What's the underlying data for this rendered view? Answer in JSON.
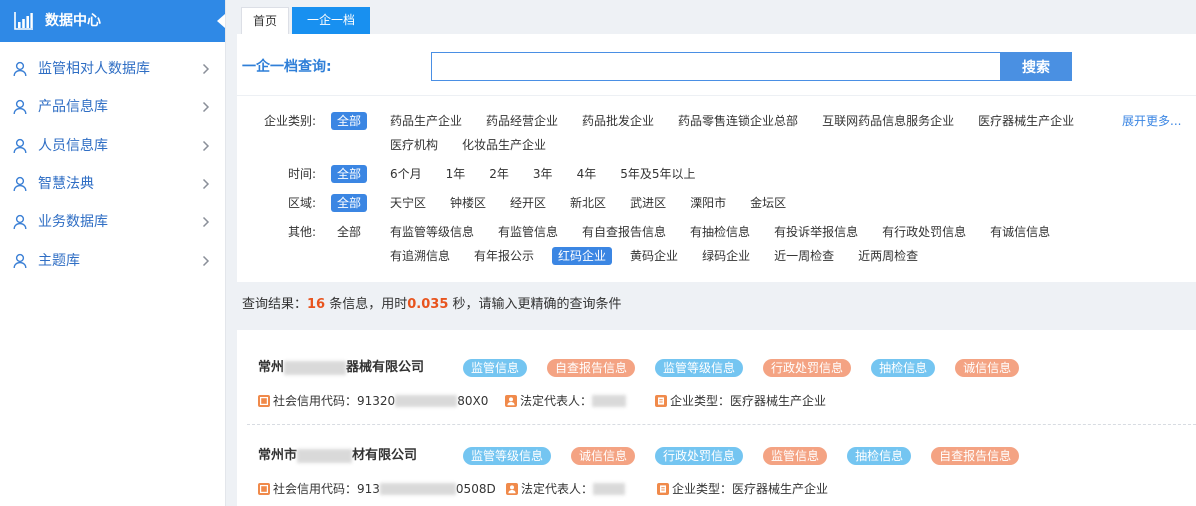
{
  "sidebar": {
    "title": "数据中心",
    "title_icon": "bar-chart-icon",
    "items": [
      {
        "label": "监管相对人数据库",
        "icon": "user-icon"
      },
      {
        "label": "产品信息库",
        "icon": "user-icon"
      },
      {
        "label": "人员信息库",
        "icon": "user-icon"
      },
      {
        "label": "智慧法典",
        "icon": "user-icon"
      },
      {
        "label": "业务数据库",
        "icon": "user-icon"
      },
      {
        "label": "主题库",
        "icon": "user-icon"
      }
    ]
  },
  "tabs": [
    {
      "label": "首页",
      "active": false
    },
    {
      "label": "一企一档",
      "active": true
    }
  ],
  "search": {
    "label": "一企一档查询:",
    "value": "",
    "button_label": "搜索"
  },
  "filters": {
    "category": {
      "label": "企业类别:",
      "all": {
        "label": "全部",
        "active": true
      },
      "options": [
        {
          "label": "药品生产企业"
        },
        {
          "label": "药品经营企业"
        },
        {
          "label": "药品批发企业"
        },
        {
          "label": "药品零售连锁企业总部"
        },
        {
          "label": "互联网药品信息服务企业"
        },
        {
          "label": "医疗器械生产企业"
        },
        {
          "label": "医疗机构"
        },
        {
          "label": "化妆品生产企业"
        }
      ],
      "expand_label": "展开更多..."
    },
    "time": {
      "label": "时间:",
      "all": {
        "label": "全部",
        "active": true
      },
      "options": [
        {
          "label": "6个月"
        },
        {
          "label": "1年"
        },
        {
          "label": "2年"
        },
        {
          "label": "3年"
        },
        {
          "label": "4年"
        },
        {
          "label": "5年及5年以上"
        }
      ]
    },
    "region": {
      "label": "区域:",
      "all": {
        "label": "全部",
        "active": true
      },
      "options": [
        {
          "label": "天宁区"
        },
        {
          "label": "钟楼区"
        },
        {
          "label": "经开区"
        },
        {
          "label": "新北区"
        },
        {
          "label": "武进区"
        },
        {
          "label": "溧阳市"
        },
        {
          "label": "金坛区"
        }
      ]
    },
    "other": {
      "label": "其他:",
      "all": {
        "label": "全部",
        "active": false
      },
      "options": [
        {
          "label": "有监管等级信息"
        },
        {
          "label": "有监管信息"
        },
        {
          "label": "有自查报告信息"
        },
        {
          "label": "有抽检信息"
        },
        {
          "label": "有投诉举报信息"
        },
        {
          "label": "有行政处罚信息"
        },
        {
          "label": "有诚信信息"
        },
        {
          "label": "有追溯信息"
        },
        {
          "label": "有年报公示"
        },
        {
          "label": "红码企业",
          "active": true
        },
        {
          "label": "黄码企业"
        },
        {
          "label": "绿码企业"
        },
        {
          "label": "近一周检查"
        },
        {
          "label": "近两周检查"
        }
      ]
    }
  },
  "summary": {
    "prefix": "查询结果：",
    "count": "16",
    "mid": " 条信息，用时",
    "time": "0.035",
    "suffix": " 秒，请输入更精确的查询条件"
  },
  "field_labels": {
    "credit_code": "社会信用代码：",
    "legal_rep": "法定代表人：",
    "company_type": "企业类型："
  },
  "results": [
    {
      "name_prefix": "常州",
      "name_suffix": "器械有限公司",
      "tags": [
        "监管信息",
        "自查报告信息",
        "监管等级信息",
        "行政处罚信息",
        "抽检信息",
        "诚信信息"
      ],
      "credit_code_prefix": "91320",
      "credit_code_suffix": "80X0",
      "company_type": "医疗器械生产企业"
    },
    {
      "name_prefix": "常州市",
      "name_suffix": "材有限公司",
      "tags": [
        "监管等级信息",
        "诚信信息",
        "行政处罚信息",
        "监管信息",
        "抽检信息",
        "自查报告信息"
      ],
      "credit_code_prefix": "913",
      "credit_code_suffix": "0508D",
      "company_type": "医疗器械生产企业"
    }
  ],
  "colors": {
    "sidebar_header": "#2f89e6",
    "active_tab": "#1890f0",
    "primary": "#3b86e3",
    "sidebar_text": "#2f6ec4",
    "tag_blue": "#74c5f1",
    "tag_orange": "#f4a383",
    "highlight": "#e8541e",
    "info_icon": "#f08a4b"
  }
}
